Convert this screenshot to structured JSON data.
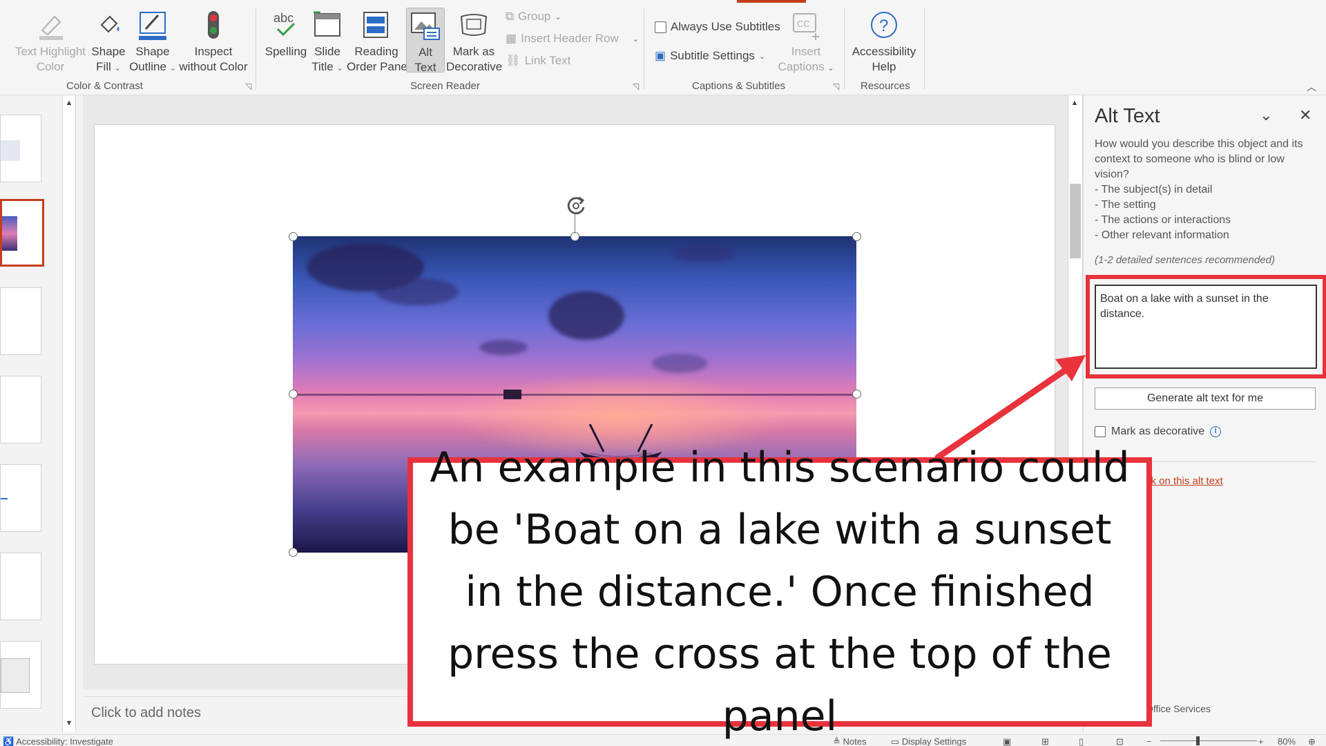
{
  "ribbon": {
    "groups": {
      "color_contrast": "Color & Contrast",
      "screen_reader": "Screen Reader",
      "captions_subtitles": "Captions & Subtitles",
      "resources": "Resources"
    },
    "buttons": {
      "text_highlight_color": [
        "Text Highlight",
        "Color"
      ],
      "shape_fill": [
        "Shape",
        "Fill"
      ],
      "shape_outline": [
        "Shape",
        "Outline"
      ],
      "inspect_without_color": [
        "Inspect",
        "without Color"
      ],
      "spelling": [
        "Spelling"
      ],
      "slide_title": [
        "Slide",
        "Title"
      ],
      "reading_order_pane": [
        "Reading",
        "Order Pane"
      ],
      "alt_text": [
        "Alt",
        "Text"
      ],
      "mark_as_decorative": [
        "Mark as",
        "Decorative"
      ],
      "insert_captions": [
        "Insert",
        "Captions"
      ],
      "accessibility_help": [
        "Accessibility",
        "Help"
      ]
    },
    "small": {
      "group": "Group",
      "insert_header_row": "Insert Header Row",
      "link_text": "Link Text",
      "always_use_subtitles": "Always Use Subtitles",
      "subtitle_settings": "Subtitle Settings"
    },
    "spelling_abc": "abc"
  },
  "notes": {
    "placeholder": "Click to add notes"
  },
  "alt_pane": {
    "title": "Alt Text",
    "description": [
      "How would you describe this object and its",
      "context to someone who is blind or low",
      "vision?",
      "- The subject(s) in detail",
      "- The setting",
      "- The actions or interactions",
      "- Other relevant information"
    ],
    "hint": "(1-2 detailed sentences recommended)",
    "alt_text_value": "Boat on a lake with a sunset in the distance.",
    "generate_button": "Generate alt text for me",
    "mark_decorative": "Mark as decorative",
    "feedback_link": "ck on this alt text",
    "office_services": "Office Services"
  },
  "status_bar": {
    "accessibility": "Accessibility: Investigate",
    "notes": "Notes",
    "display_settings": "Display Settings",
    "zoom": "80%"
  },
  "callout": {
    "text": "An example in this scenario could be 'Boat on a lake with a sunset in the distance.' Once finished press the cross at the top of the panel"
  },
  "colors": {
    "accent": "#c43e1c",
    "annotation_red": "#e8323c"
  }
}
